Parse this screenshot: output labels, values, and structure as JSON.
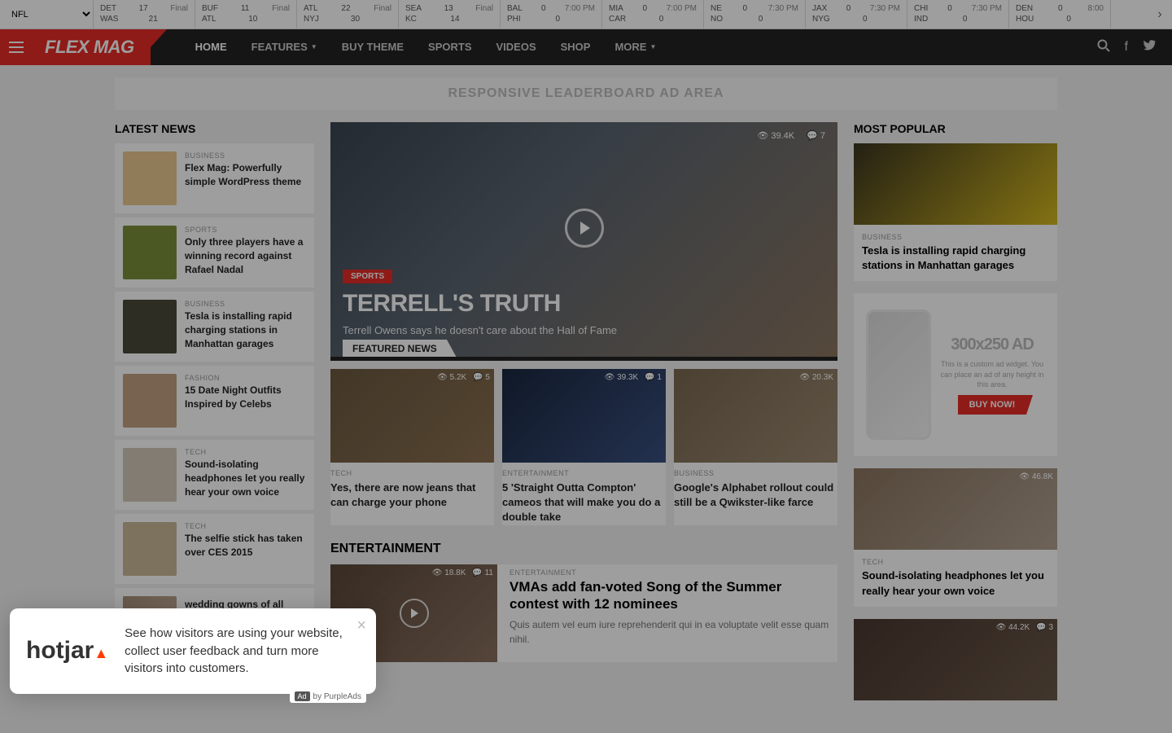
{
  "scoreboard": {
    "league": "NFL",
    "games": [
      {
        "t1": "DET",
        "s1": "17",
        "t2": "WAS",
        "s2": "21",
        "status": "Final"
      },
      {
        "t1": "BUF",
        "s1": "11",
        "t2": "ATL",
        "s2": "10",
        "status": "Final"
      },
      {
        "t1": "ATL",
        "s1": "22",
        "t2": "NYJ",
        "s2": "30",
        "status": "Final"
      },
      {
        "t1": "SEA",
        "s1": "13",
        "t2": "KC",
        "s2": "14",
        "status": "Final"
      },
      {
        "t1": "BAL",
        "s1": "0",
        "t2": "PHI",
        "s2": "0",
        "status": "7:00 PM"
      },
      {
        "t1": "MIA",
        "s1": "0",
        "t2": "CAR",
        "s2": "0",
        "status": "7:00 PM"
      },
      {
        "t1": "NE",
        "s1": "0",
        "t2": "NO",
        "s2": "0",
        "status": "7:30 PM"
      },
      {
        "t1": "JAX",
        "s1": "0",
        "t2": "NYG",
        "s2": "0",
        "status": "7:30 PM"
      },
      {
        "t1": "CHI",
        "s1": "0",
        "t2": "IND",
        "s2": "0",
        "status": "7:30 PM"
      },
      {
        "t1": "DEN",
        "s1": "0",
        "t2": "HOU",
        "s2": "0",
        "status": "8:00"
      }
    ]
  },
  "logo": "FLEX MAG",
  "nav": [
    "HOME",
    "FEATURES",
    "BUY THEME",
    "SPORTS",
    "VIDEOS",
    "SHOP",
    "MORE"
  ],
  "ad_leader": "RESPONSIVE LEADERBOARD AD AREA",
  "latest_heading": "LATEST NEWS",
  "latest": [
    {
      "cat": "BUSINESS",
      "title": "Flex Mag: Powerfully simple WordPress theme",
      "bg": "#e8c890"
    },
    {
      "cat": "SPORTS",
      "title": "Only three players have a winning record against Rafael Nadal",
      "bg": "#7a8f3a"
    },
    {
      "cat": "BUSINESS",
      "title": "Tesla is installing rapid charging stations in Manhattan garages",
      "bg": "#4a4a3a"
    },
    {
      "cat": "FASHION",
      "title": "15 Date Night Outfits Inspired by Celebs",
      "bg": "#c0a080"
    },
    {
      "cat": "TECH",
      "title": "Sound-isolating headphones let you really hear your own voice",
      "bg": "#d4c8b8"
    },
    {
      "cat": "TECH",
      "title": "The selfie stick has taken over CES 2015",
      "bg": "#c8b898"
    }
  ],
  "hero": {
    "cat": "SPORTS",
    "title": "TERRELL'S TRUTH",
    "sub": "Terrell Owens says he doesn't care about the Hall of Fame",
    "views": "39.4K",
    "comments": "7",
    "featured": "FEATURED NEWS"
  },
  "cards": [
    {
      "cat": "TECH",
      "title": "Yes, there are now jeans that can charge your phone",
      "views": "5.2K",
      "comments": "5",
      "bg": "linear-gradient(135deg,#6b5840,#8a7050)"
    },
    {
      "cat": "ENTERTAINMENT",
      "title": "5 'Straight Outta Compton' cameos that will make you do a double take",
      "views": "39.3K",
      "comments": "1",
      "bg": "linear-gradient(135deg,#1a2840,#3a5080)"
    },
    {
      "cat": "BUSINESS",
      "title": "Google's Alphabet rollout could still be a Qwikster-like farce",
      "views": "20.3K",
      "comments": "",
      "bg": "linear-gradient(135deg,#7a6850,#9a8870)"
    }
  ],
  "ent_heading": "ENTERTAINMENT",
  "ent": {
    "cat": "ENTERTAINMENT",
    "title": "VMAs add fan-voted Song of the Summer contest with 12 nominees",
    "desc": "Quis autem vel eum iure reprehenderit qui in ea voluptate velit esse quam nihil.",
    "views": "18.8K",
    "comments": "11"
  },
  "pop_heading": "MOST POPULAR",
  "popular": [
    {
      "cat": "BUSINESS",
      "title": "Tesla is installing rapid charging stations in Manhattan garages",
      "views": "",
      "comments": "",
      "bg": "linear-gradient(135deg,#3a3520,#d4b820)"
    },
    {
      "cat": "TECH",
      "title": "Sound-isolating headphones let you really hear your own voice",
      "views": "46.8K",
      "comments": "",
      "bg": "linear-gradient(135deg,#8a7560,#b0a090)"
    }
  ],
  "ad_box": {
    "big": "300x250 AD",
    "small": "This is a custom ad widget. You can place an ad of any height in this area.",
    "btn": "BUY NOW!"
  },
  "pop3": {
    "views": "44.2K",
    "comments": "3",
    "bg": "linear-gradient(135deg,#4a3830,#6a5848)"
  },
  "latest7": {
    "title": "wedding gowns of all time"
  },
  "popup": {
    "logo": "hotjar",
    "text": "See how visitors are using your website, collect user feedback and turn more visitors into customers.",
    "ad_label": "Ad",
    "by": "by PurpleAds"
  }
}
